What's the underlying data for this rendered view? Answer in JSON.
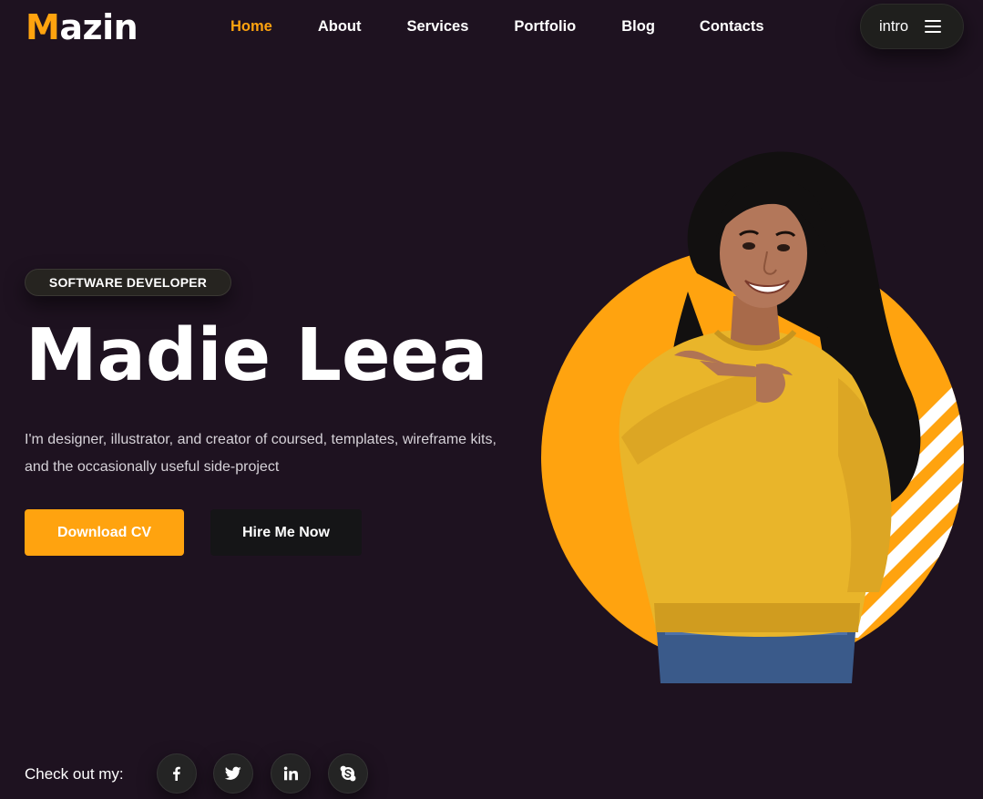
{
  "brand": {
    "first_letter": "M",
    "rest": "azin",
    "accent_color": "#ffa30f",
    "background_color": "#1e1220"
  },
  "nav": {
    "items": [
      {
        "label": "Home",
        "active": true
      },
      {
        "label": "About",
        "active": false
      },
      {
        "label": "Services",
        "active": false
      },
      {
        "label": "Portfolio",
        "active": false
      },
      {
        "label": "Blog",
        "active": false
      },
      {
        "label": "Contacts",
        "active": false
      }
    ]
  },
  "intro_button": {
    "label": "intro",
    "icon": "hamburger-menu-icon"
  },
  "hero": {
    "badge": "SOFTWARE DEVELOPER",
    "name": "Madie Leea",
    "description": "I'm designer, illustrator, and creator of coursed, templates, wireframe kits, and the occasionally useful side-project",
    "primary_button": "Download CV",
    "secondary_button": "Hire Me Now",
    "image_alt": "smiling woman in yellow sweater pointing to the side"
  },
  "social": {
    "label": "Check out my:",
    "links": [
      {
        "name": "facebook",
        "icon": "facebook-icon"
      },
      {
        "name": "twitter",
        "icon": "twitter-icon"
      },
      {
        "name": "linkedin",
        "icon": "linkedin-icon"
      },
      {
        "name": "skype",
        "icon": "skype-icon"
      }
    ]
  }
}
